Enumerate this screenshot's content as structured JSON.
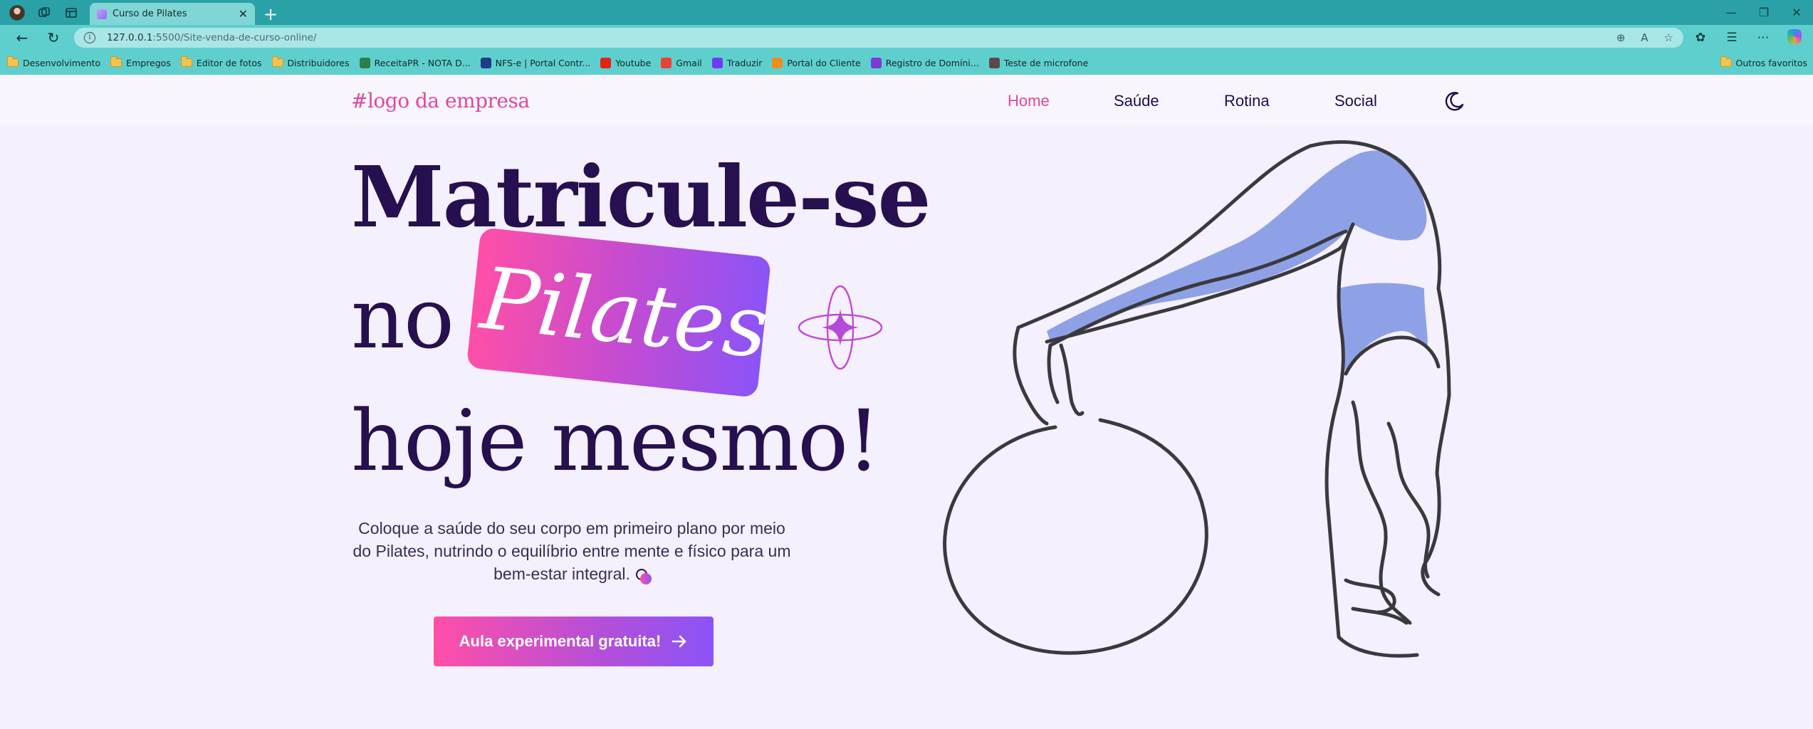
{
  "browser": {
    "tab_title": "Curso de Pilates",
    "url_host": "127.0.0.1",
    "url_port_path": ":5500/Site-venda-de-curso-online/",
    "bookmarks": [
      {
        "label": "Desenvolvimento",
        "icon": "folder-icon"
      },
      {
        "label": "Empregos",
        "icon": "folder-icon"
      },
      {
        "label": "Editor de fotos",
        "icon": "folder-icon"
      },
      {
        "label": "Distribuidores",
        "icon": "folder-icon"
      },
      {
        "label": "ReceitaPR - NOTA D...",
        "icon": "receita-favicon"
      },
      {
        "label": "NFS-e | Portal Contr...",
        "icon": "nfse-favicon"
      },
      {
        "label": "Youtube",
        "icon": "youtube-favicon"
      },
      {
        "label": "Gmail",
        "icon": "gmail-favicon"
      },
      {
        "label": "Traduzir",
        "icon": "translate-favicon"
      },
      {
        "label": "Portal do Cliente",
        "icon": "portal-favicon"
      },
      {
        "label": "Registro de Domíni...",
        "icon": "registro-favicon"
      },
      {
        "label": "Teste de microfone",
        "icon": "microphone-favicon"
      }
    ],
    "other_favorites": "Outros favoritos"
  },
  "site": {
    "logo": "#logo da empresa",
    "nav": [
      "Home",
      "Saúde",
      "Rotina",
      "Social"
    ],
    "active_nav": "Home",
    "hero": {
      "line1": "Matricule-se",
      "line2_prefix": "no",
      "highlight": "Pilates",
      "line3": "hoje mesmo!",
      "text_line1": "Coloque a saúde do seu corpo em primeiro plano por meio",
      "text_line2": "do Pilates, nutrindo o equilíbrio entre mente e físico para um",
      "text_line3": "bem-estar integral.",
      "cta": "Aula experimental gratuita!"
    }
  },
  "colors": {
    "brand_pink": "#ff4fa7",
    "brand_purple": "#8b54f7",
    "heading": "#26104f",
    "page_bg": "#f4f0fd",
    "browser_teal": "#2aa1a6"
  }
}
